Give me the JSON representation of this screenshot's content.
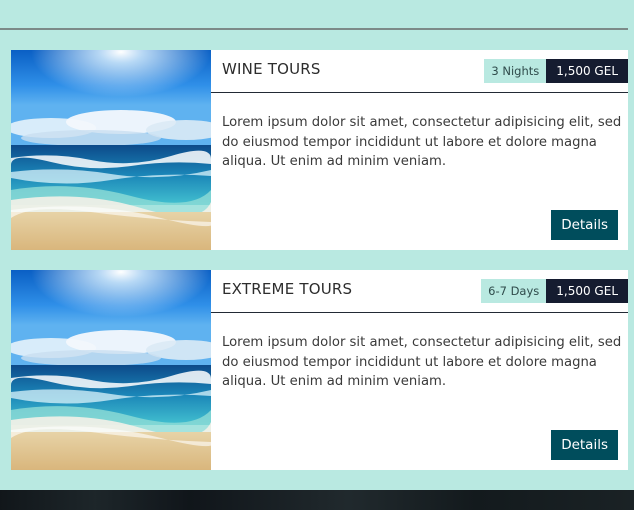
{
  "tours": [
    {
      "title": "WINE TOURS",
      "duration": "3 Nights",
      "price": "1,500 GEL",
      "description": "Lorem ipsum dolor sit amet, consectetur adipisicing elit, sed do eiusmod tempor incididunt ut labore et dolore magna aliqua. Ut enim ad minim veniam.",
      "button_label": "Details",
      "image": "beach-ocean-image"
    },
    {
      "title": "EXTREME TOURS",
      "duration": "6-7 Days",
      "price": "1,500 GEL",
      "description": "Lorem ipsum dolor sit amet, consectetur adipisicing elit, sed do eiusmod tempor incididunt ut labore et dolore magna aliqua. Ut enim ad minim veniam.",
      "button_label": "Details",
      "image": "beach-ocean-image"
    }
  ],
  "colors": {
    "page_background": "#b9e9e1",
    "price_badge": "#151c30",
    "duration_badge": "#b9e9e1",
    "button": "#004d5c"
  }
}
